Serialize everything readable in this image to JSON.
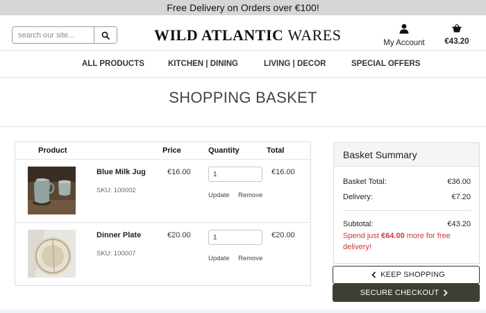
{
  "banner": {
    "text": "Free Delivery on Orders over €100!"
  },
  "header": {
    "search_placeholder": "search our site...",
    "logo": {
      "bold": "WILD ATLANTIC",
      "thin": "WARES"
    },
    "account_label": "My Account",
    "cart_total": "€43.20"
  },
  "nav": {
    "items": [
      {
        "label": "ALL PRODUCTS"
      },
      {
        "label": "KITCHEN | DINING"
      },
      {
        "label": "LIVING | DECOR"
      },
      {
        "label": "SPECIAL OFFERS"
      }
    ]
  },
  "page": {
    "title": "SHOPPING BASKET"
  },
  "table": {
    "headers": {
      "product": "Product",
      "price": "Price",
      "quantity": "Quantity",
      "total": "Total"
    },
    "rows": [
      {
        "name": "Blue Milk Jug",
        "sku": "SKU: 100002",
        "price": "€16.00",
        "quantity": "1",
        "total": "€16.00",
        "update_label": "Update",
        "remove_label": "Remove",
        "image": "blue-milk-jug-photo"
      },
      {
        "name": "Dinner Plate",
        "sku": "SKU: 100007",
        "price": "€20.00",
        "quantity": "1",
        "total": "€20.00",
        "update_label": "Update",
        "remove_label": "Remove",
        "image": "dinner-plate-photo"
      }
    ]
  },
  "summary": {
    "title": "Basket Summary",
    "basket_total_label": "Basket Total:",
    "basket_total_value": "€36.00",
    "delivery_label": "Delivery:",
    "delivery_value": "€7.20",
    "subtotal_label": "Subtotal:",
    "subtotal_value": "€43.20",
    "spend_prefix": "Spend just",
    "spend_amount": "€64.00",
    "spend_suffix": "more for free delivery!"
  },
  "buttons": {
    "keep_shopping": "KEEP SHOPPING",
    "secure_checkout": "SECURE CHECKOUT"
  },
  "colors": {
    "banner_bg": "#d6d6d6",
    "checkout_bg": "#3e3f33",
    "alert_red": "#d0343a"
  },
  "icons": {
    "search": "search-icon",
    "account": "user-icon",
    "cart": "basket-icon",
    "keep_shopping": "chevron-left-icon",
    "checkout": "chevron-right-icon"
  }
}
